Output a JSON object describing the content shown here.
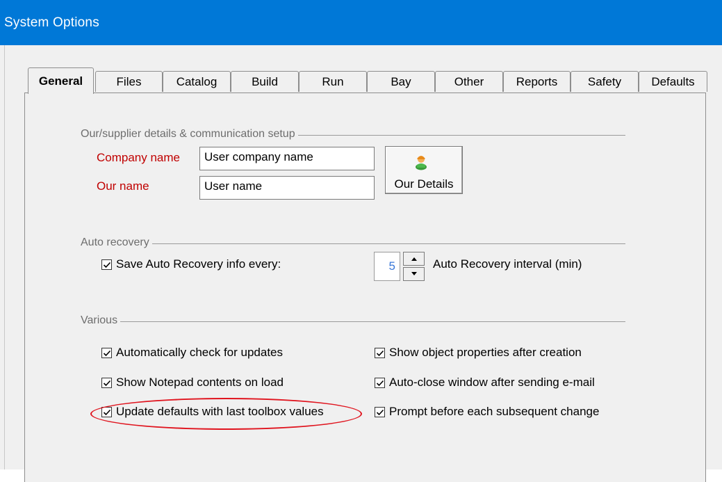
{
  "window": {
    "title": "System Options"
  },
  "tabs": [
    {
      "label": "General",
      "active": true
    },
    {
      "label": "Files"
    },
    {
      "label": "Catalog"
    },
    {
      "label": "Build"
    },
    {
      "label": "Run"
    },
    {
      "label": "Bay"
    },
    {
      "label": "Other"
    },
    {
      "label": "Reports"
    },
    {
      "label": "Safety"
    },
    {
      "label": "Defaults"
    }
  ],
  "supplier": {
    "group_label": "Our/supplier details & communication setup",
    "company_name_label": "Company name",
    "company_name_value": "User company name",
    "our_name_label": "Our name",
    "our_name_value": "User name",
    "details_button_label": "Our Details",
    "details_button_icon": "person-icon"
  },
  "auto_recovery": {
    "group_label": "Auto recovery",
    "save_checkbox_label": "Save Auto Recovery info every:",
    "save_checked": true,
    "interval_value": "5",
    "interval_label": "Auto Recovery interval (min)"
  },
  "various": {
    "group_label": "Various",
    "left_options": [
      {
        "label": "Automatically check for updates",
        "checked": true
      },
      {
        "label": "Show Notepad contents on load",
        "checked": true
      },
      {
        "label": "Update defaults with last toolbox values",
        "checked": true
      }
    ],
    "right_options": [
      {
        "label": "Show object properties after creation",
        "checked": true
      },
      {
        "label": "Auto-close window after sending e-mail",
        "checked": true
      },
      {
        "label": "Prompt before each subsequent change",
        "checked": true
      }
    ]
  },
  "colors": {
    "title_bar": "#0078d7",
    "required_label": "#c00000",
    "spin_value": "#3a78d8",
    "highlight": "#e0141e"
  }
}
